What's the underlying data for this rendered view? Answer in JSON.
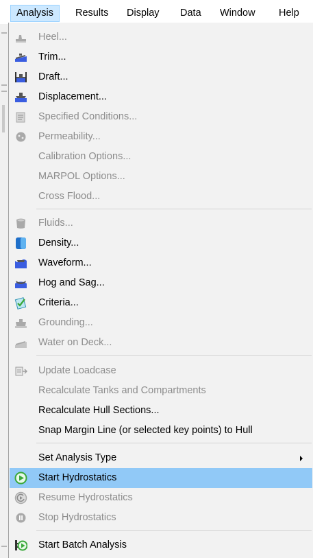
{
  "menubar": {
    "items": [
      "Analysis",
      "Results",
      "Display",
      "Data",
      "Window",
      "Help"
    ]
  },
  "menu": {
    "items": [
      {
        "label": "Heel...",
        "icon": "heel-icon",
        "enabled": false
      },
      {
        "label": "Trim...",
        "icon": "trim-icon",
        "enabled": true
      },
      {
        "label": "Draft...",
        "icon": "draft-icon",
        "enabled": true
      },
      {
        "label": "Displacement...",
        "icon": "displacement-icon",
        "enabled": true
      },
      {
        "label": "Specified Conditions...",
        "icon": "specified-conditions-icon",
        "enabled": false
      },
      {
        "label": "Permeability...",
        "icon": "permeability-icon",
        "enabled": false
      },
      {
        "label": "Calibration Options...",
        "enabled": false
      },
      {
        "label": "MARPOL Options...",
        "enabled": false
      },
      {
        "label": "Cross Flood...",
        "enabled": false
      },
      {
        "label": "Fluids...",
        "icon": "fluids-icon",
        "enabled": false
      },
      {
        "label": "Density...",
        "icon": "density-icon",
        "enabled": true
      },
      {
        "label": "Waveform...",
        "icon": "waveform-icon",
        "enabled": true
      },
      {
        "label": "Hog and Sag...",
        "icon": "hog-sag-icon",
        "enabled": true
      },
      {
        "label": "Criteria...",
        "icon": "criteria-icon",
        "enabled": true
      },
      {
        "label": "Grounding...",
        "icon": "grounding-icon",
        "enabled": false
      },
      {
        "label": "Water on Deck...",
        "icon": "water-on-deck-icon",
        "enabled": false
      },
      {
        "label": "Update Loadcase",
        "icon": "update-loadcase-icon",
        "enabled": false
      },
      {
        "label": "Recalculate Tanks and Compartments",
        "enabled": false
      },
      {
        "label": "Recalculate Hull Sections...",
        "enabled": true
      },
      {
        "label": "Snap Margin Line (or selected key points) to Hull",
        "enabled": true
      },
      {
        "label": "Set Analysis Type",
        "enabled": true,
        "submenu": true
      },
      {
        "label": "Start Hydrostatics",
        "icon": "play-icon",
        "enabled": true,
        "highlighted": true
      },
      {
        "label": "Resume Hydrostatics",
        "icon": "resume-icon",
        "enabled": false
      },
      {
        "label": "Stop Hydrostatics",
        "icon": "pause-icon",
        "enabled": false
      },
      {
        "label": "Start Batch Analysis",
        "icon": "batch-play-icon",
        "enabled": true
      }
    ]
  },
  "colors": {
    "highlight": "#91c9f7",
    "menubar_open": "#cce8ff",
    "disabled_text": "#8c8c8c",
    "icon_blue": "#3a5de0",
    "icon_green": "#3aa83a"
  }
}
